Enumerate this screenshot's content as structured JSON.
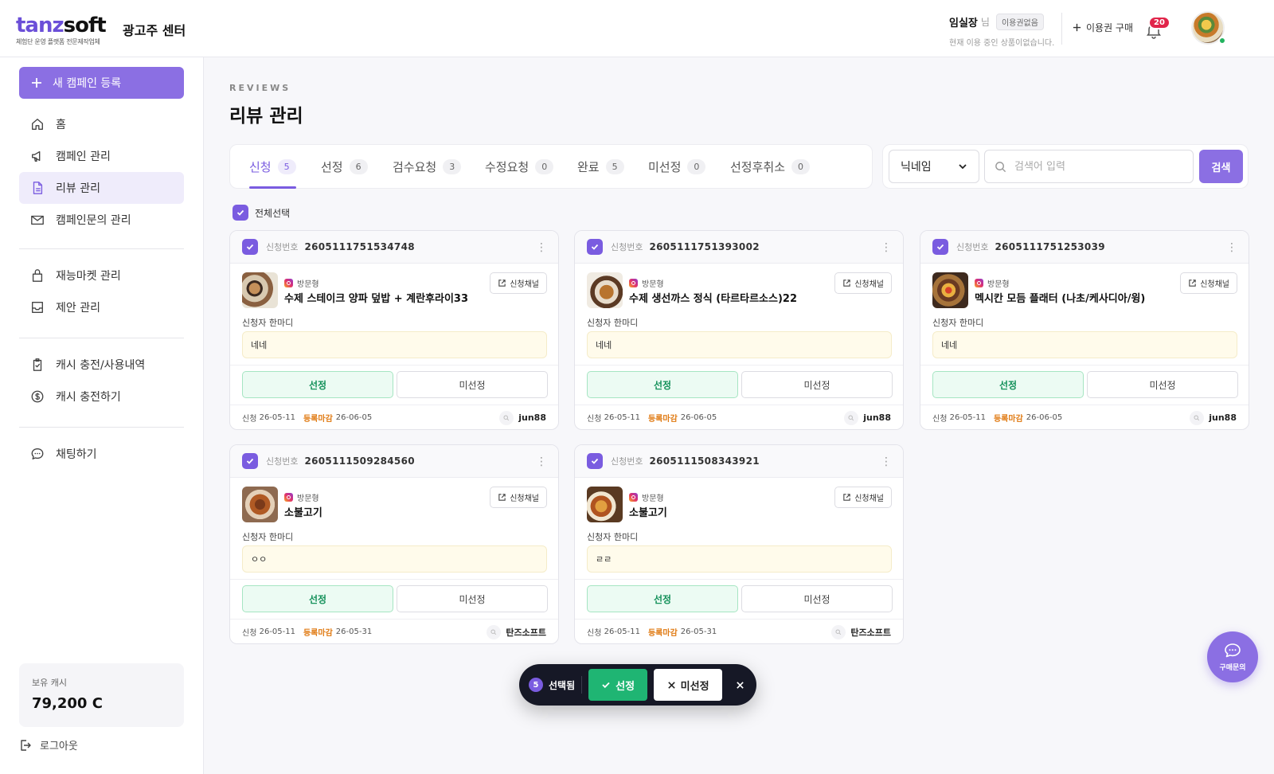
{
  "brand": {
    "logo_part1": "tanz",
    "logo_part2": "soft",
    "logo_sub": "체험단 운영 플랫폼 전문제작업체",
    "center_name": "광고주 센터"
  },
  "user": {
    "name": "임실장",
    "suffix": "님",
    "plan_badge": "이용권없음",
    "status": "현재 이용 중인 상품이없습니다."
  },
  "header": {
    "buy_label": "이용권 구매",
    "notification_count": "20"
  },
  "sidebar": {
    "new_campaign": "새 캠페인 등록",
    "items": [
      {
        "label": "홈",
        "icon": "home-icon"
      },
      {
        "label": "캠페인 관리",
        "icon": "megaphone-icon"
      },
      {
        "label": "리뷰 관리",
        "icon": "document-icon"
      },
      {
        "label": "캠페인문의 관리",
        "icon": "mail-icon"
      },
      {
        "label": "재능마켓 관리",
        "icon": "bag-icon"
      },
      {
        "label": "제안 관리",
        "icon": "inbox-icon"
      },
      {
        "label": "캐시 충전/사용내역",
        "icon": "clipboard-icon"
      },
      {
        "label": "캐시 충전하기",
        "icon": "dollar-icon"
      },
      {
        "label": "채팅하기",
        "icon": "chat-icon"
      }
    ],
    "cash_label": "보유 캐시",
    "cash_value": "79,200 C",
    "logout": "로그아웃"
  },
  "page": {
    "eyebrow": "REVIEWS",
    "title": "리뷰 관리"
  },
  "tabs": [
    {
      "label": "신청",
      "count": "5"
    },
    {
      "label": "선정",
      "count": "6"
    },
    {
      "label": "검수요청",
      "count": "3"
    },
    {
      "label": "수정요청",
      "count": "0"
    },
    {
      "label": "완료",
      "count": "5"
    },
    {
      "label": "미선정",
      "count": "0"
    },
    {
      "label": "선정후취소",
      "count": "0"
    }
  ],
  "search": {
    "filter_value": "닉네임",
    "placeholder": "검색어 입력",
    "button": "검색"
  },
  "select_all_label": "전체선택",
  "card_labels": {
    "app_no": "신청번호",
    "channel": "신청채널",
    "message": "신청자 한마디",
    "select": "선정",
    "unselect": "미선정",
    "applied": "신청",
    "deadline": "등록마감"
  },
  "cards": [
    {
      "no": "2605111751534748",
      "type": "방문형",
      "name": "수제 스테이크 양파 덮밥 + 계란후라이33",
      "message": "네네",
      "applied": "26-05-11",
      "deadline": "26-06-05",
      "user": "jun88"
    },
    {
      "no": "2605111751393002",
      "type": "방문형",
      "name": "수제 생선까스 정식 (타르타르소스)22",
      "message": "네네",
      "applied": "26-05-11",
      "deadline": "26-06-05",
      "user": "jun88"
    },
    {
      "no": "2605111751253039",
      "type": "방문형",
      "name": "멕시칸 모듬 플래터 (나초/케사디아/윙)",
      "message": "네네",
      "applied": "26-05-11",
      "deadline": "26-06-05",
      "user": "jun88"
    },
    {
      "no": "2605111509284560",
      "type": "방문형",
      "name": "소불고기",
      "message": "ㅇㅇ",
      "applied": "26-05-11",
      "deadline": "26-05-31",
      "user": "탄즈소프트"
    },
    {
      "no": "2605111508343921",
      "type": "방문형",
      "name": "소불고기",
      "message": "ㄹㄹ",
      "applied": "26-05-11",
      "deadline": "26-05-31",
      "user": "탄즈소프트"
    }
  ],
  "actionbar": {
    "count": "5",
    "selected_label": "선택됨",
    "select": "선정",
    "unselect": "미선정"
  },
  "inquiry_label": "구매문의",
  "colors": {
    "accent": "#8b6fe3",
    "success": "#1fb573",
    "deadline": "#e07b14",
    "badge": "#e1254a"
  }
}
